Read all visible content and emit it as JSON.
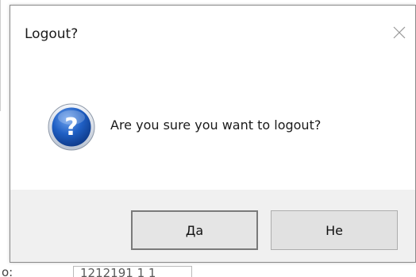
{
  "dialog": {
    "title": "Logout?",
    "close_icon": "close-icon",
    "message": "Are you sure you want to logout?",
    "icon": "question-icon",
    "buttons": {
      "yes_label": "Да",
      "no_label": "Не"
    }
  },
  "background": {
    "field_label": "o:",
    "field_value": "1212191 1 1"
  },
  "colors": {
    "icon_blue": "#1e5fbf",
    "footer_bg": "#f0f0f0",
    "button_bg": "#e1e1e1"
  }
}
